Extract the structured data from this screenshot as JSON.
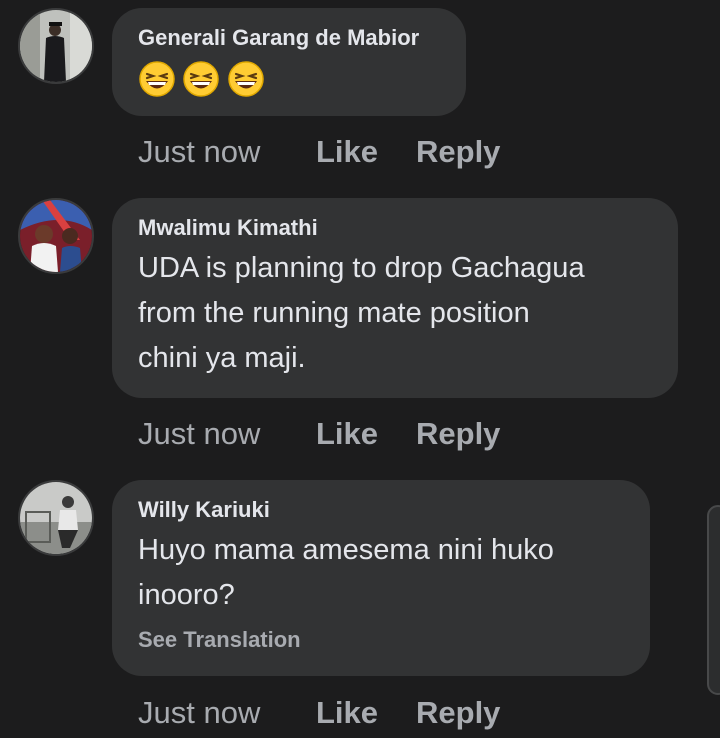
{
  "comments": [
    {
      "author": "Generali Garang de Mabior",
      "text": "",
      "emojis": [
        "grinning-squinting-face",
        "grinning-squinting-face",
        "grinning-squinting-face"
      ],
      "time": "Just now",
      "like_label": "Like",
      "reply_label": "Reply"
    },
    {
      "author": "Mwalimu Kimathi",
      "text_lines": [
        "UDA is planning to drop Gachagua",
        "from the running mate position",
        "chini ya maji."
      ],
      "time": "Just now",
      "like_label": "Like",
      "reply_label": "Reply"
    },
    {
      "author": "Willy Kariuki",
      "text_lines": [
        "Huyo mama amesema nini huko",
        "inooro?"
      ],
      "see_translation": "See Translation",
      "time": "Just now",
      "like_label": "Like",
      "reply_label": "Reply"
    }
  ],
  "colors": {
    "background": "#1c1c1d",
    "bubble": "#323334",
    "primary_text": "#e4e6eb",
    "secondary_text": "#a8abb0"
  }
}
